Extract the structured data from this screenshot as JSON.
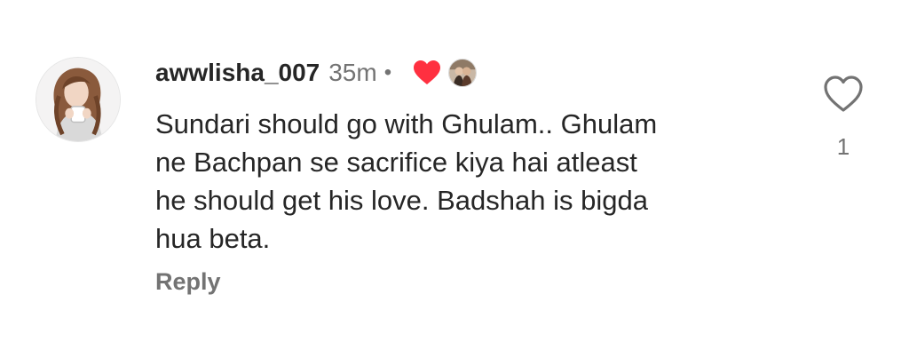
{
  "comment": {
    "username": "awwlisha_007",
    "time": "35m",
    "separator": "•",
    "lines": [
      "Sundari should go with Ghulam.. Ghulam",
      "ne Bachpan se sacrifice kiya hai atleast",
      "he should get his love. Badshah is bigda",
      "hua beta."
    ],
    "reply_label": "Reply",
    "like_count": "1"
  },
  "icons": {
    "avatar": "user-avatar-illustration",
    "creator_heart": "filled-heart-icon",
    "creator_avatar": "creator-avatar-icon",
    "like": "heart-outline-icon"
  },
  "colors": {
    "text_primary": "#262626",
    "text_secondary": "#737373",
    "heart_red": "#ff3040",
    "background": "#ffffff"
  }
}
